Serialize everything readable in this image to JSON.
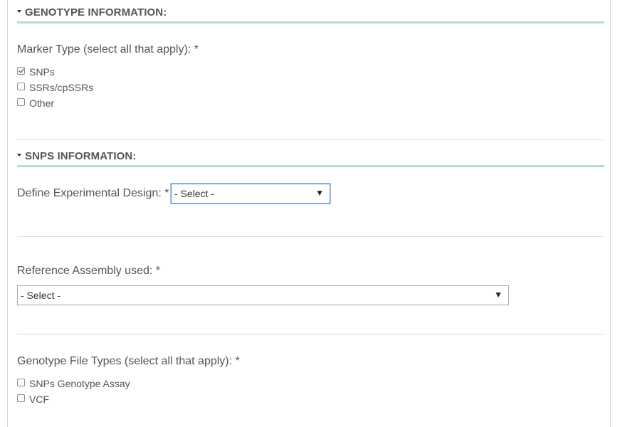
{
  "genotype_section": {
    "title": "GENOTYPE INFORMATION:",
    "marker_type_label": "Marker Type (select all that apply): *",
    "marker_options": [
      {
        "label": "SNPs",
        "checked": true
      },
      {
        "label": "SSRs/cpSSRs",
        "checked": false
      },
      {
        "label": "Other",
        "checked": false
      }
    ]
  },
  "snps_section": {
    "title": "SNPS INFORMATION:",
    "design_label": "Define Experimental Design: *",
    "design_select_value": "- Select -",
    "reference_label": "Reference Assembly used: *",
    "reference_select_value": "- Select -",
    "file_types_label": "Genotype File Types (select all that apply): *",
    "file_type_options": [
      {
        "label": "SNPs Genotype Assay",
        "checked": false
      },
      {
        "label": "VCF",
        "checked": false
      }
    ]
  },
  "icons": {
    "collapse": "caret-down-icon",
    "dropdown": "dropdown-arrow-icon",
    "dropdown_glyph": "▼"
  }
}
